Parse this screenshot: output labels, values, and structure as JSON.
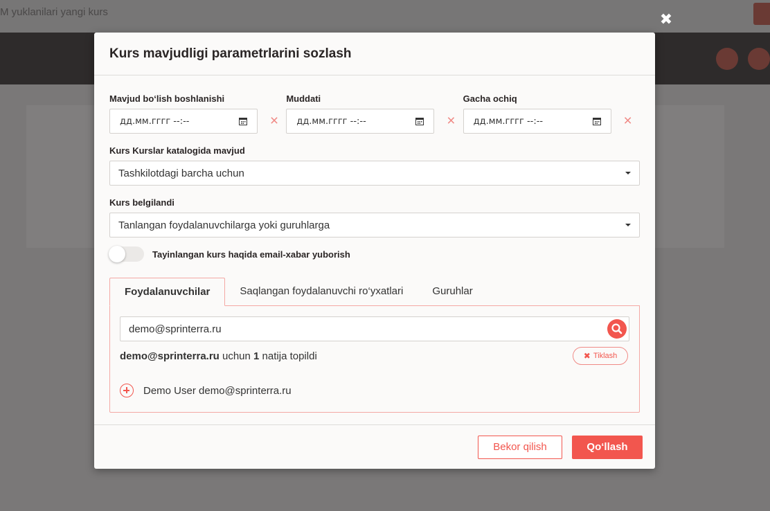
{
  "background": {
    "page_title": "M yuklanilari yangi kurs"
  },
  "modal": {
    "title": "Kurs mavjudligi parametrlarini sozlash",
    "dates": [
      {
        "label": "Mavjud bo‘lish boshlanishi",
        "placeholder": "дд.мм.гггг --:--"
      },
      {
        "label": "Muddati",
        "placeholder": "дд.мм.гггг --:--"
      },
      {
        "label": "Gacha ochiq",
        "placeholder": "дд.мм.гггг --:--"
      }
    ],
    "catalog": {
      "label": "Kurs Kurslar katalogida mavjud",
      "value": "Tashkilotdagi barcha uchun"
    },
    "assigned": {
      "label": "Kurs belgilandi",
      "value": "Tanlangan foydalanuvchilarga yoki guruhlarga"
    },
    "email_toggle": {
      "label": "Tayinlangan kurs haqida email-xabar yuborish",
      "on": false
    },
    "tabs": [
      {
        "label": "Foydalanuvchilar",
        "active": true
      },
      {
        "label": "Saqlangan foydalanuvchi ro‘yxatlari",
        "active": false
      },
      {
        "label": "Guruhlar",
        "active": false
      }
    ],
    "search": {
      "value": "demo@sprinterra.ru"
    },
    "result": {
      "query": "demo@sprinterra.ru",
      "mid_text": " uchun ",
      "count": "1",
      "suffix": " natija topildi",
      "reset_label": "Tiklash"
    },
    "user_item": {
      "label": "Demo User demo@sprinterra.ru"
    },
    "footer": {
      "cancel_label": "Bekor qilish",
      "apply_label": "Qo‘llash"
    }
  },
  "colors": {
    "accent": "#f2564e",
    "overlay": "#7a7878"
  }
}
